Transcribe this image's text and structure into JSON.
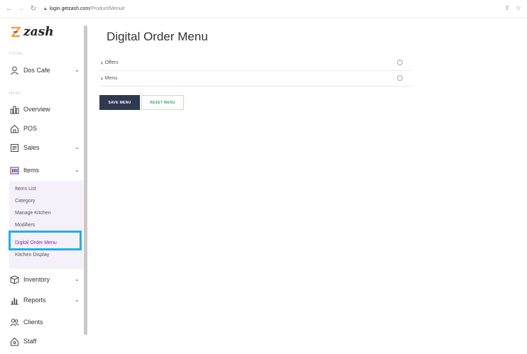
{
  "browser": {
    "url_domain": "login.getzash.com",
    "url_path": "/Product/Menu#"
  },
  "brand": {
    "name": "zash"
  },
  "sidebar": {
    "store_section_label": "STORE",
    "store_name": "Dos Cafe",
    "menu_section_label": "MENU",
    "items": [
      {
        "label": "Overview",
        "icon": "chart-icon"
      },
      {
        "label": "POS",
        "icon": "home-icon"
      },
      {
        "label": "Sales",
        "icon": "receipt-icon"
      },
      {
        "label": "Items",
        "icon": "grid-icon"
      },
      {
        "label": "Inventory",
        "icon": "box-icon"
      },
      {
        "label": "Reports",
        "icon": "bar-chart-icon"
      },
      {
        "label": "Clients",
        "icon": "users-icon"
      },
      {
        "label": "Staff",
        "icon": "staff-icon"
      }
    ],
    "items_submenu": [
      "Items List",
      "Category",
      "Manage Kitchen",
      "Modifiers",
      "Digital Order Menu",
      "Kitchen Display"
    ],
    "active_submenu": "Digital Order Menu"
  },
  "main": {
    "title": "Digital Order Menu",
    "accordion": [
      "Offers",
      "Menu"
    ],
    "save_label": "SAVE MENU",
    "reset_label": "RESET MENU"
  },
  "colors": {
    "highlight": "#1fb1e3",
    "save_button": "#2e3a4f",
    "reset_text": "#3fa96b",
    "submenu_bg": "#f6f0fa",
    "active_sub": "#7b2fa8"
  }
}
